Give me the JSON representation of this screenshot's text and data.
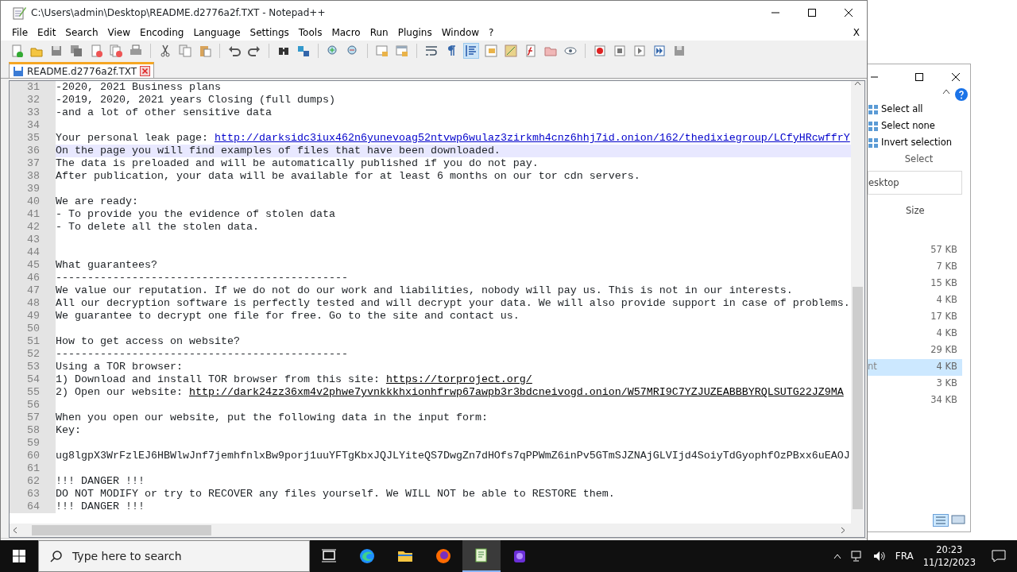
{
  "window": {
    "title": "C:\\Users\\admin\\Desktop\\README.d2776a2f.TXT - Notepad++"
  },
  "menu": [
    "File",
    "Edit",
    "Search",
    "View",
    "Encoding",
    "Language",
    "Settings",
    "Tools",
    "Macro",
    "Run",
    "Plugins",
    "Window",
    "?"
  ],
  "menu_close": "X",
  "toolbar": [
    {
      "pressed": false
    },
    {
      "pressed": false
    },
    {
      "pressed": false
    },
    {
      "pressed": false
    },
    {
      "pressed": false
    },
    {
      "pressed": false
    },
    {
      "pressed": false
    },
    {
      "pressed": false
    },
    {
      "pressed": false
    },
    {
      "pressed": false
    },
    {
      "pressed": false
    },
    {
      "pressed": false
    },
    {
      "pressed": false
    },
    {
      "pressed": false
    },
    {
      "pressed": false
    },
    {
      "pressed": false
    },
    {
      "pressed": false
    },
    {
      "pressed": false
    },
    {
      "pressed": false
    },
    {
      "pressed": false
    },
    {
      "pressed": true
    },
    {
      "pressed": false
    },
    {
      "pressed": false
    },
    {
      "pressed": false
    },
    {
      "pressed": false
    },
    {
      "pressed": false
    },
    {
      "pressed": false
    },
    {
      "pressed": false
    },
    {
      "pressed": false
    },
    {
      "pressed": false
    },
    {
      "pressed": false
    }
  ],
  "tabs": [
    {
      "label": "README.d2776a2f.TXT",
      "selected": true
    }
  ],
  "lines": [
    {
      "number": "31",
      "current": false,
      "segments": [
        {
          "kind": "text",
          "text": "-2020, 2021 Business plans"
        }
      ]
    },
    {
      "number": "32",
      "current": false,
      "segments": [
        {
          "kind": "text",
          "text": "-2019, 2020, 2021 years Closing (full dumps)"
        }
      ]
    },
    {
      "number": "33",
      "current": false,
      "segments": [
        {
          "kind": "text",
          "text": "-and a lot of other sensitive data"
        }
      ]
    },
    {
      "number": "34",
      "current": false
    },
    {
      "number": "35",
      "current": false,
      "segments": [
        {
          "kind": "text",
          "text": "Your personal leak page: "
        },
        {
          "kind": "link",
          "color": "#0000cc",
          "text": "http://darksidc3iux462n6yunevoag52ntvwp6wulaz3zirkmh4cnz6hhj7id.onion/162/thedixiegroup/LCfyHRcwffrY"
        }
      ]
    },
    {
      "number": "36",
      "current": true,
      "segments": [
        {
          "kind": "text",
          "text": "On the page you will find examples of files that have been downloaded."
        }
      ]
    },
    {
      "number": "37",
      "current": false,
      "segments": [
        {
          "kind": "text",
          "text": "The data is preloaded and will be automatically published if you do not pay."
        }
      ]
    },
    {
      "number": "38",
      "current": false,
      "segments": [
        {
          "kind": "text",
          "text": "After publication, your data will be available for at least 6 months on our tor cdn servers."
        }
      ]
    },
    {
      "number": "39",
      "current": false
    },
    {
      "number": "40",
      "current": false,
      "segments": [
        {
          "kind": "text",
          "text": "We are ready:"
        }
      ]
    },
    {
      "number": "41",
      "current": false,
      "segments": [
        {
          "kind": "text",
          "text": "- To provide you the evidence of stolen data"
        }
      ]
    },
    {
      "number": "42",
      "current": false,
      "segments": [
        {
          "kind": "text",
          "text": "- To delete all the stolen data."
        }
      ]
    },
    {
      "number": "43",
      "current": false
    },
    {
      "number": "44",
      "current": false
    },
    {
      "number": "45",
      "current": false,
      "segments": [
        {
          "kind": "text",
          "text": "What guarantees?"
        }
      ]
    },
    {
      "number": "46",
      "current": false,
      "segments": [
        {
          "kind": "text",
          "text": "----------------------------------------------"
        }
      ]
    },
    {
      "number": "47",
      "current": false,
      "segments": [
        {
          "kind": "text",
          "text": "We value our reputation. If we do not do our work and liabilities, nobody will pay us. This is not in our interests."
        }
      ]
    },
    {
      "number": "48",
      "current": false,
      "segments": [
        {
          "kind": "text",
          "text": "All our decryption software is perfectly tested and will decrypt your data. We will also provide support in case of problems."
        }
      ]
    },
    {
      "number": "49",
      "current": false,
      "segments": [
        {
          "kind": "text",
          "text": "We guarantee to decrypt one file for free. Go to the site and contact us."
        }
      ]
    },
    {
      "number": "50",
      "current": false
    },
    {
      "number": "51",
      "current": false,
      "segments": [
        {
          "kind": "text",
          "text": "How to get access on website?"
        }
      ]
    },
    {
      "number": "52",
      "current": false,
      "segments": [
        {
          "kind": "text",
          "text": "----------------------------------------------"
        }
      ]
    },
    {
      "number": "53",
      "current": false,
      "segments": [
        {
          "kind": "text",
          "text": "Using a TOR browser:"
        }
      ]
    },
    {
      "number": "54",
      "current": false,
      "segments": [
        {
          "kind": "text",
          "text": "1) Download and install TOR browser from this site: "
        },
        {
          "kind": "link",
          "color": "#000000",
          "text": "https://torproject.org/"
        }
      ]
    },
    {
      "number": "55",
      "current": false,
      "segments": [
        {
          "kind": "text",
          "text": "2) Open our website: "
        },
        {
          "kind": "link",
          "color": "#000000",
          "text": "http://dark24zz36xm4v2phwe7yvnkkkhxionhfrwp67awpb3r3bdcneivogd.onion/W57MRI9C7YZJUZEABBBYRQLSUTG22JZ9MA"
        }
      ]
    },
    {
      "number": "56",
      "current": false
    },
    {
      "number": "57",
      "current": false,
      "segments": [
        {
          "kind": "text",
          "text": "When you open our website, put the following data in the input form:"
        }
      ]
    },
    {
      "number": "58",
      "current": false,
      "segments": [
        {
          "kind": "text",
          "text": "Key:"
        }
      ]
    },
    {
      "number": "59",
      "current": false
    },
    {
      "number": "60",
      "current": false,
      "segments": [
        {
          "kind": "text",
          "text": "ug8lgpX3WrFzlEJ6HBWlwJnf7jemhfnlxBw9porj1uuYFTgKbxJQJLYiteQS7DwgZn7dHOfs7qPPWmZ6inPv5GTmSJZNAjGLVIjd4SoiyTdGyophfOzPBxx6uEAOJ"
        }
      ]
    },
    {
      "number": "61",
      "current": false
    },
    {
      "number": "62",
      "current": false,
      "segments": [
        {
          "kind": "text",
          "text": "!!! DANGER !!!"
        }
      ]
    },
    {
      "number": "63",
      "current": false,
      "segments": [
        {
          "kind": "text",
          "text": "DO NOT MODIFY or try to RECOVER any files yourself. We WILL NOT be able to RESTORE them."
        }
      ]
    },
    {
      "number": "64",
      "current": false,
      "segments": [
        {
          "kind": "text",
          "text": "!!! DANGER !!!"
        }
      ]
    }
  ],
  "explorer": {
    "ribbon_items": [
      "Select all",
      "Select none",
      "Invert selection"
    ],
    "ribbon_group": "Select",
    "address": "esktop",
    "column": "Size",
    "rows": [
      {
        "size": "57 KB",
        "selected": false
      },
      {
        "size": "7 KB",
        "selected": false
      },
      {
        "size": "15 KB",
        "selected": false
      },
      {
        "size": "4 KB",
        "selected": false
      },
      {
        "size": "17 KB",
        "selected": false
      },
      {
        "size": "4 KB",
        "selected": false
      },
      {
        "size": "29 KB",
        "selected": false
      },
      {
        "name": "nt",
        "size": "4 KB",
        "selected": true
      },
      {
        "size": "3 KB",
        "selected": false
      },
      {
        "size": "34 KB",
        "selected": false
      }
    ]
  },
  "taskbar": {
    "search_placeholder": "Type here to search",
    "apps": [
      {
        "active": false
      },
      {
        "active": false
      },
      {
        "active": false
      },
      {
        "active": false
      },
      {
        "active": true
      },
      {
        "active": false
      }
    ],
    "language": "FRA",
    "time": "20:23",
    "date": "11/12/2023"
  }
}
